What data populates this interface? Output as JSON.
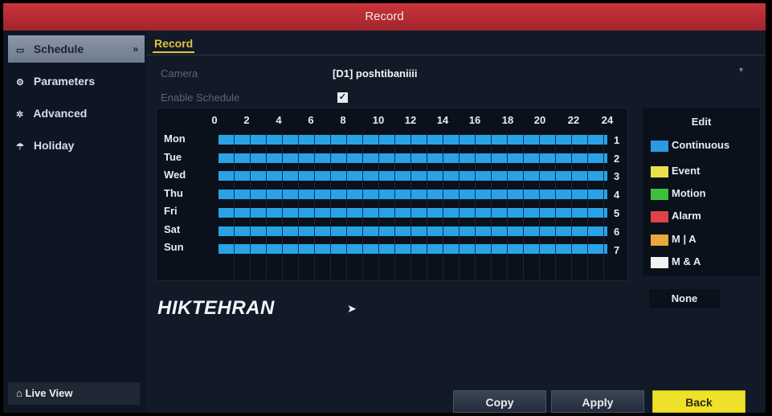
{
  "window": {
    "title": "Record"
  },
  "sidebar": {
    "items": [
      {
        "label": "Schedule",
        "icon": "schedule-icon",
        "active": true
      },
      {
        "label": "Parameters",
        "icon": "parameters-icon",
        "active": false
      },
      {
        "label": "Advanced",
        "icon": "advanced-icon",
        "active": false
      },
      {
        "label": "Holiday",
        "icon": "holiday-icon",
        "active": false
      }
    ],
    "live_view": "Live View"
  },
  "main": {
    "tab": "Record",
    "camera_label": "Camera",
    "camera_value": "[D1] poshtibaniiii",
    "enable_schedule_label": "Enable Schedule",
    "enable_schedule_checked": true
  },
  "schedule": {
    "hours": [
      "0",
      "2",
      "4",
      "6",
      "8",
      "10",
      "12",
      "14",
      "16",
      "18",
      "20",
      "22",
      "24"
    ],
    "days": [
      "Mon",
      "Tue",
      "Wed",
      "Thu",
      "Fri",
      "Sat",
      "Sun"
    ],
    "row_numbers": [
      "1",
      "2",
      "3",
      "4",
      "5",
      "6",
      "7"
    ],
    "fill_color": "#2aa2e8",
    "coverage": "continuous 0-24 all days"
  },
  "edit": {
    "title": "Edit",
    "legend": [
      {
        "label": "Continuous",
        "color": "#2a9be2"
      },
      {
        "label": "Event",
        "color": "#e8e04a"
      },
      {
        "label": "Motion",
        "color": "#3cc23a"
      },
      {
        "label": "Alarm",
        "color": "#e0424a"
      },
      {
        "label": "M | A",
        "color": "#e8a83a"
      },
      {
        "label": "M & A",
        "color": "#f2f2f2"
      }
    ],
    "none_label": "None"
  },
  "watermark": "HIKTEHRAN",
  "buttons": {
    "copy": "Copy",
    "apply": "Apply",
    "back": "Back"
  }
}
